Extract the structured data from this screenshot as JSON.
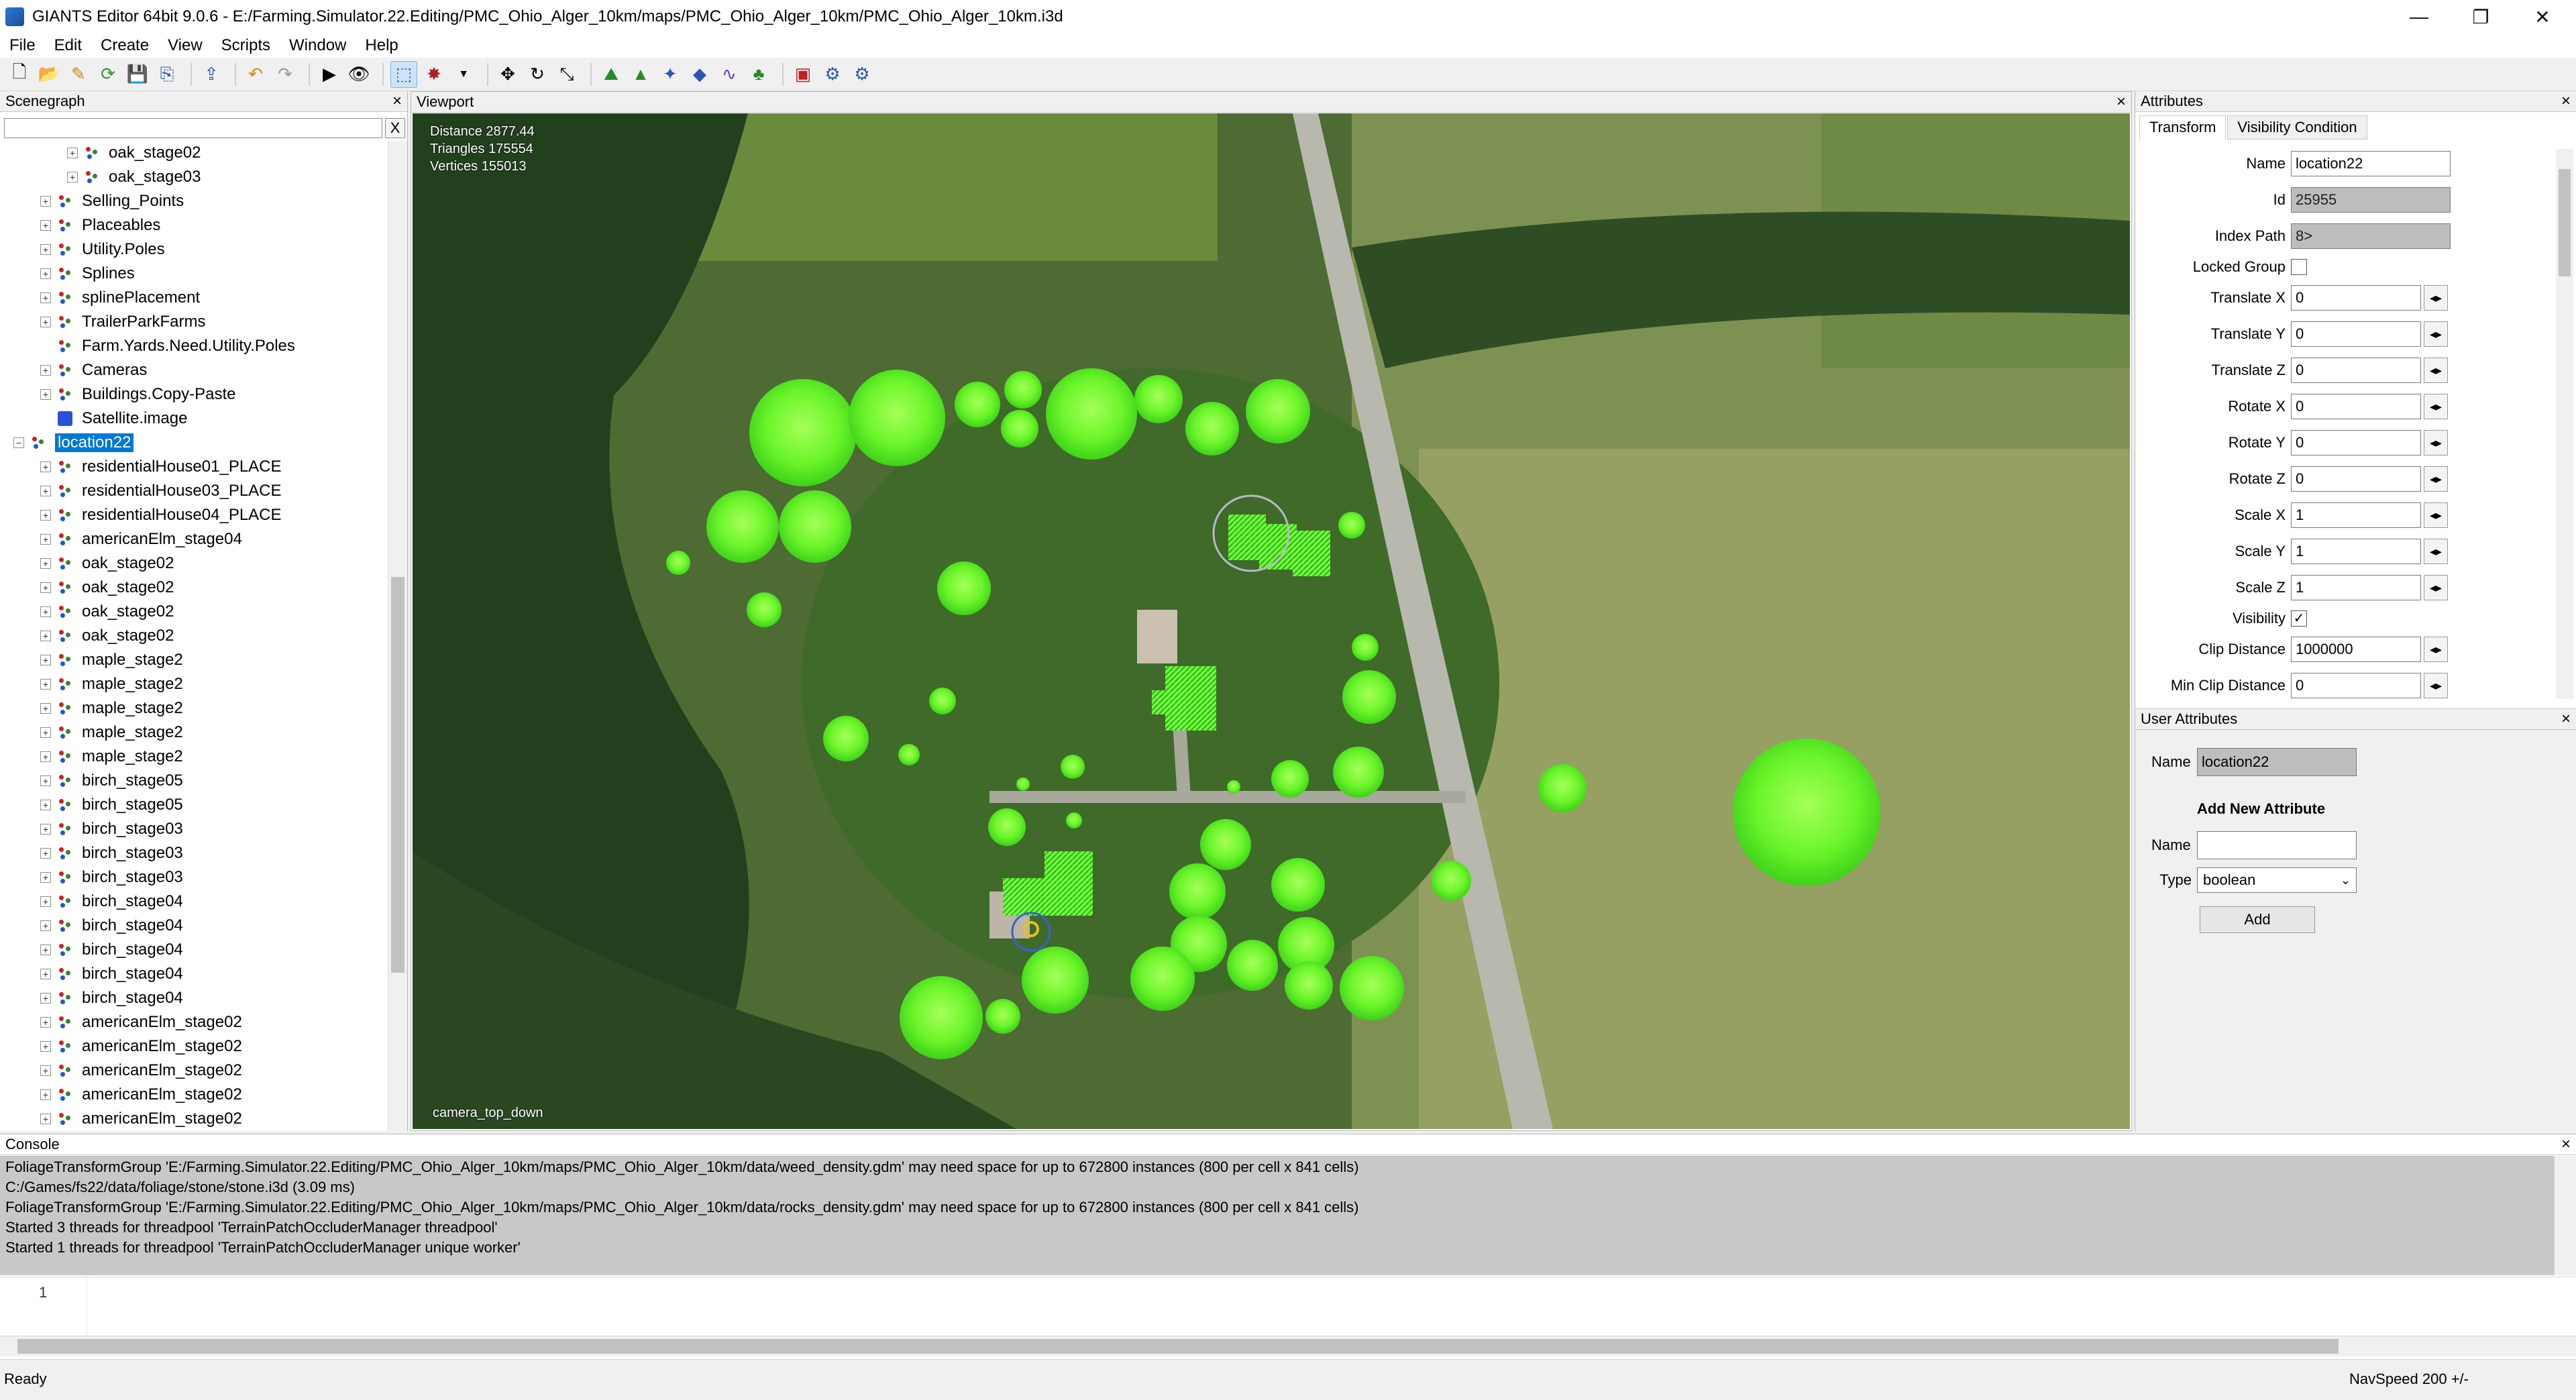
{
  "window": {
    "title": "GIANTS Editor 64bit 9.0.6 - E:/Farming.Simulator.22.Editing/PMC_Ohio_Alger_10km/maps/PMC_Ohio_Alger_10km/PMC_Ohio_Alger_10km.i3d",
    "minimize_icon": "minimize-icon",
    "maximize_icon": "restore-icon",
    "close_icon": "close-icon"
  },
  "menu": [
    "File",
    "Edit",
    "Create",
    "View",
    "Scripts",
    "Window",
    "Help"
  ],
  "toolbar_icons": [
    "new-file-icon",
    "open-file-icon",
    "edit-file-icon",
    "reload-icon",
    "save-icon",
    "save-as-icon",
    "export-icon",
    "undo-icon",
    "redo-icon",
    "play-icon",
    "visibility-icon",
    "select-icon",
    "paint-icon",
    "dropdown-icon",
    "move-icon",
    "rotate-icon",
    "scale-icon",
    "terrain-sculpt-icon",
    "terrain-paint-icon",
    "foliage-paint-icon",
    "place-object-icon",
    "spline-icon",
    "tree-icon",
    "shop-icon",
    "settings-icon",
    "plugin-icon"
  ],
  "scenegraph": {
    "title": "Scenegraph",
    "close": "×",
    "search_clear": "X",
    "nodes": [
      {
        "label": "oak_stage02",
        "depth": 2,
        "expand": "+",
        "icon": "transform-group-icon"
      },
      {
        "label": "oak_stage03",
        "depth": 2,
        "expand": "+",
        "icon": "transform-group-icon"
      },
      {
        "label": "Selling_Points",
        "depth": 1,
        "expand": "+",
        "icon": "transform-group-icon"
      },
      {
        "label": "Placeables",
        "depth": 1,
        "expand": "+",
        "icon": "transform-group-icon"
      },
      {
        "label": "Utility.Poles",
        "depth": 1,
        "expand": "+",
        "icon": "transform-group-icon"
      },
      {
        "label": "Splines",
        "depth": 1,
        "expand": "+",
        "icon": "transform-group-icon"
      },
      {
        "label": "splinePlacement",
        "depth": 1,
        "expand": "+",
        "icon": "transform-group-icon"
      },
      {
        "label": "TrailerParkFarms",
        "depth": 1,
        "expand": "+",
        "icon": "transform-group-icon"
      },
      {
        "label": "Farm.Yards.Need.Utility.Poles",
        "depth": 1,
        "expand": "",
        "icon": "transform-group-icon"
      },
      {
        "label": "Cameras",
        "depth": 1,
        "expand": "+",
        "icon": "transform-group-icon"
      },
      {
        "label": "Buildings.Copy-Paste",
        "depth": 1,
        "expand": "+",
        "icon": "transform-group-icon"
      },
      {
        "label": "Satellite.image",
        "depth": 1,
        "expand": "",
        "icon": "shape-icon"
      },
      {
        "label": "location22",
        "depth": 0,
        "expand": "−",
        "icon": "transform-group-icon",
        "selected": true
      },
      {
        "label": "residentialHouse01_PLACE",
        "depth": 1,
        "expand": "+",
        "icon": "transform-group-icon"
      },
      {
        "label": "residentialHouse03_PLACE",
        "depth": 1,
        "expand": "+",
        "icon": "transform-group-icon"
      },
      {
        "label": "residentialHouse04_PLACE",
        "depth": 1,
        "expand": "+",
        "icon": "transform-group-icon"
      },
      {
        "label": "americanElm_stage04",
        "depth": 1,
        "expand": "+",
        "icon": "transform-group-icon"
      },
      {
        "label": "oak_stage02",
        "depth": 1,
        "expand": "+",
        "icon": "transform-group-icon"
      },
      {
        "label": "oak_stage02",
        "depth": 1,
        "expand": "+",
        "icon": "transform-group-icon"
      },
      {
        "label": "oak_stage02",
        "depth": 1,
        "expand": "+",
        "icon": "transform-group-icon"
      },
      {
        "label": "oak_stage02",
        "depth": 1,
        "expand": "+",
        "icon": "transform-group-icon"
      },
      {
        "label": "maple_stage2",
        "depth": 1,
        "expand": "+",
        "icon": "transform-group-icon"
      },
      {
        "label": "maple_stage2",
        "depth": 1,
        "expand": "+",
        "icon": "transform-group-icon"
      },
      {
        "label": "maple_stage2",
        "depth": 1,
        "expand": "+",
        "icon": "transform-group-icon"
      },
      {
        "label": "maple_stage2",
        "depth": 1,
        "expand": "+",
        "icon": "transform-group-icon"
      },
      {
        "label": "maple_stage2",
        "depth": 1,
        "expand": "+",
        "icon": "transform-group-icon"
      },
      {
        "label": "birch_stage05",
        "depth": 1,
        "expand": "+",
        "icon": "transform-group-icon"
      },
      {
        "label": "birch_stage05",
        "depth": 1,
        "expand": "+",
        "icon": "transform-group-icon"
      },
      {
        "label": "birch_stage03",
        "depth": 1,
        "expand": "+",
        "icon": "transform-group-icon"
      },
      {
        "label": "birch_stage03",
        "depth": 1,
        "expand": "+",
        "icon": "transform-group-icon"
      },
      {
        "label": "birch_stage03",
        "depth": 1,
        "expand": "+",
        "icon": "transform-group-icon"
      },
      {
        "label": "birch_stage04",
        "depth": 1,
        "expand": "+",
        "icon": "transform-group-icon"
      },
      {
        "label": "birch_stage04",
        "depth": 1,
        "expand": "+",
        "icon": "transform-group-icon"
      },
      {
        "label": "birch_stage04",
        "depth": 1,
        "expand": "+",
        "icon": "transform-group-icon"
      },
      {
        "label": "birch_stage04",
        "depth": 1,
        "expand": "+",
        "icon": "transform-group-icon"
      },
      {
        "label": "birch_stage04",
        "depth": 1,
        "expand": "+",
        "icon": "transform-group-icon"
      },
      {
        "label": "americanElm_stage02",
        "depth": 1,
        "expand": "+",
        "icon": "transform-group-icon"
      },
      {
        "label": "americanElm_stage02",
        "depth": 1,
        "expand": "+",
        "icon": "transform-group-icon"
      },
      {
        "label": "americanElm_stage02",
        "depth": 1,
        "expand": "+",
        "icon": "transform-group-icon"
      },
      {
        "label": "americanElm_stage02",
        "depth": 1,
        "expand": "+",
        "icon": "transform-group-icon"
      },
      {
        "label": "americanElm_stage02",
        "depth": 1,
        "expand": "+",
        "icon": "transform-group-icon"
      }
    ]
  },
  "viewport": {
    "title": "Viewport",
    "close": "×",
    "stats": {
      "distance": "Distance 2877.44",
      "triangles": "Triangles 175554",
      "vertices": "Vertices 155013"
    },
    "camera": "camera_top_down"
  },
  "attributes": {
    "title": "Attributes",
    "close": "×",
    "tabs": [
      "Transform",
      "Visibility Condition"
    ],
    "active_tab": "Transform",
    "fields": {
      "name": {
        "label": "Name",
        "value": "location22"
      },
      "id": {
        "label": "Id",
        "value": "25955"
      },
      "index_path": {
        "label": "Index Path",
        "value": "8>"
      },
      "locked_group": {
        "label": "Locked Group",
        "checked": false
      },
      "translate_x": {
        "label": "Translate X",
        "value": "0"
      },
      "translate_y": {
        "label": "Translate Y",
        "value": "0"
      },
      "translate_z": {
        "label": "Translate Z",
        "value": "0"
      },
      "rotate_x": {
        "label": "Rotate X",
        "value": "0"
      },
      "rotate_y": {
        "label": "Rotate Y",
        "value": "0"
      },
      "rotate_z": {
        "label": "Rotate Z",
        "value": "0"
      },
      "scale_x": {
        "label": "Scale X",
        "value": "1"
      },
      "scale_y": {
        "label": "Scale Y",
        "value": "1"
      },
      "scale_z": {
        "label": "Scale Z",
        "value": "1"
      },
      "visibility": {
        "label": "Visibility",
        "checked": true
      },
      "clip_distance": {
        "label": "Clip Distance",
        "value": "1000000"
      },
      "min_clip_distance": {
        "label": "Min Clip Distance",
        "value": "0"
      }
    },
    "spin_glyph": "◂▸",
    "check_glyph": "✓"
  },
  "user_attributes": {
    "title": "User Attributes",
    "close": "×",
    "name_label": "Name",
    "name_value": "location22",
    "add_heading": "Add New Attribute",
    "new_name_label": "Name",
    "new_name_value": "",
    "type_label": "Type",
    "type_value": "boolean",
    "add_button": "Add"
  },
  "console": {
    "title": "Console",
    "close": "×",
    "lines": [
      "FoliageTransformGroup 'E:/Farming.Simulator.22.Editing/PMC_Ohio_Alger_10km/maps/PMC_Ohio_Alger_10km/data/weed_density.gdm' may need space for up to 672800 instances (800 per cell x 841 cells)",
      "C:/Games/fs22/data/foliage/stone/stone.i3d (3.09 ms)",
      "FoliageTransformGroup 'E:/Farming.Simulator.22.Editing/PMC_Ohio_Alger_10km/maps/PMC_Ohio_Alger_10km/data/rocks_density.gdm' may need space for up to 672800 instances (800 per cell x 841 cells)",
      "Started 3 threads for threadpool 'TerrainPatchOccluderManager threadpool'",
      "Started 1 threads for threadpool 'TerrainPatchOccluderManager unique worker'"
    ],
    "input_line_number": "1",
    "input_value": ""
  },
  "status": {
    "left": "Ready",
    "right": "NavSpeed 200 +/-"
  }
}
